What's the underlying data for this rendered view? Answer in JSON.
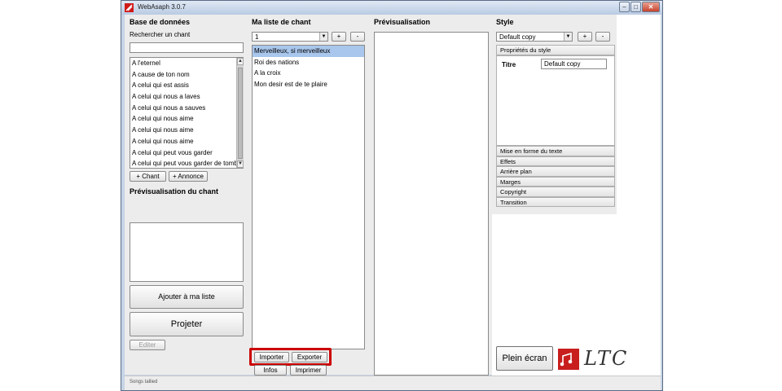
{
  "window": {
    "title": "WebAsaph 3.0.7",
    "controls": {
      "minimize": "‒",
      "maximize": "□",
      "close": "✕"
    }
  },
  "database": {
    "heading": "Base de données",
    "search_label": "Rechercher un chant",
    "search_value": "",
    "songs": [
      "A l'eternel",
      "A cause de ton nom",
      "A celui qui est assis",
      "A celui qui nous a laves",
      "A celui qui nous a sauves",
      "A celui qui nous aime",
      "A celui qui nous aime",
      "A celui qui nous aime",
      "A celui qui peut vous garder",
      "A celui qui peut vous garder de tombe"
    ],
    "add_song_button": "+ Chant",
    "add_announce_button": "+ Annonce",
    "preview_heading": "Prévisualisation du chant",
    "add_to_list_button": "Ajouter à ma liste",
    "project_button": "Projeter",
    "edit_button": "Editer"
  },
  "my_list": {
    "heading": "Ma liste de chant",
    "selector_value": "1",
    "add_button": "+",
    "remove_button": "-",
    "items": [
      "Merveilleux, si merveilleux",
      "Roi des nations",
      "A la croix",
      "Mon desir est de te plaire"
    ],
    "selected_index": 0,
    "import_button": "Importer",
    "export_button": "Exporter",
    "info_button": "Infos",
    "print_button": "Imprimer"
  },
  "preview": {
    "heading": "Prévisualisation"
  },
  "style": {
    "heading": "Style",
    "selector_value": "Default copy",
    "add_button": "+",
    "remove_button": "-",
    "properties_header": "Propriétés du style",
    "title_label": "Titre",
    "title_value": "Default copy",
    "sections": [
      "Mise en forme du texte",
      "Effets",
      "Arrière plan",
      "Marges",
      "Copyright",
      "Transition"
    ],
    "fullscreen_button": "Plein écran",
    "logo_text": "LTC"
  },
  "status": {
    "text": "Songs tallied"
  },
  "colors": {
    "highlight": "#cc0000",
    "selection": "#a9c6ec",
    "titlebar": "#c7d4e6"
  },
  "icons": [
    "app-logo-icon",
    "scroll-up-icon",
    "scroll-down-icon",
    "dropdown-arrow-icon",
    "music-note-icon"
  ]
}
